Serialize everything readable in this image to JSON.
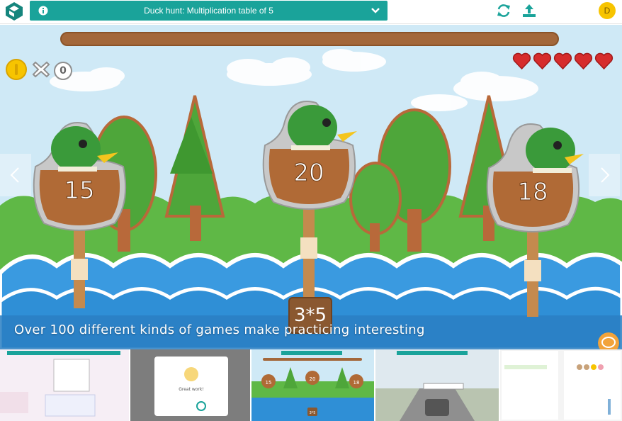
{
  "header": {
    "title": "Duck hunt: Multiplication table of 5",
    "avatar_initial": "D",
    "icons": [
      "logo-icon",
      "info-icon",
      "chevron-down-icon",
      "refresh-icon",
      "upload-icon"
    ]
  },
  "game": {
    "coins": "",
    "wrong_count": "0",
    "lives": 5,
    "ducks": [
      {
        "number": "15"
      },
      {
        "number": "20"
      },
      {
        "number": "18"
      }
    ],
    "question": "3*5"
  },
  "slide": {
    "caption": "Over 100 different kinds of games make practicing interesting"
  },
  "thumbnails": [
    {
      "name": "word-grid-game"
    },
    {
      "name": "great-work-screen",
      "text": "Great work!"
    },
    {
      "name": "duck-hunt-game",
      "numbers": [
        "15",
        "20",
        "18"
      ],
      "question": "3*5"
    },
    {
      "name": "car-game"
    },
    {
      "name": "exercise-list"
    }
  ],
  "colors": {
    "teal": "#1aa39a",
    "sky": "#cfe9f6",
    "grass": "#5fb846",
    "water": "#2f8fd6",
    "heart": "#d62c2c",
    "wood": "#a3673a"
  }
}
